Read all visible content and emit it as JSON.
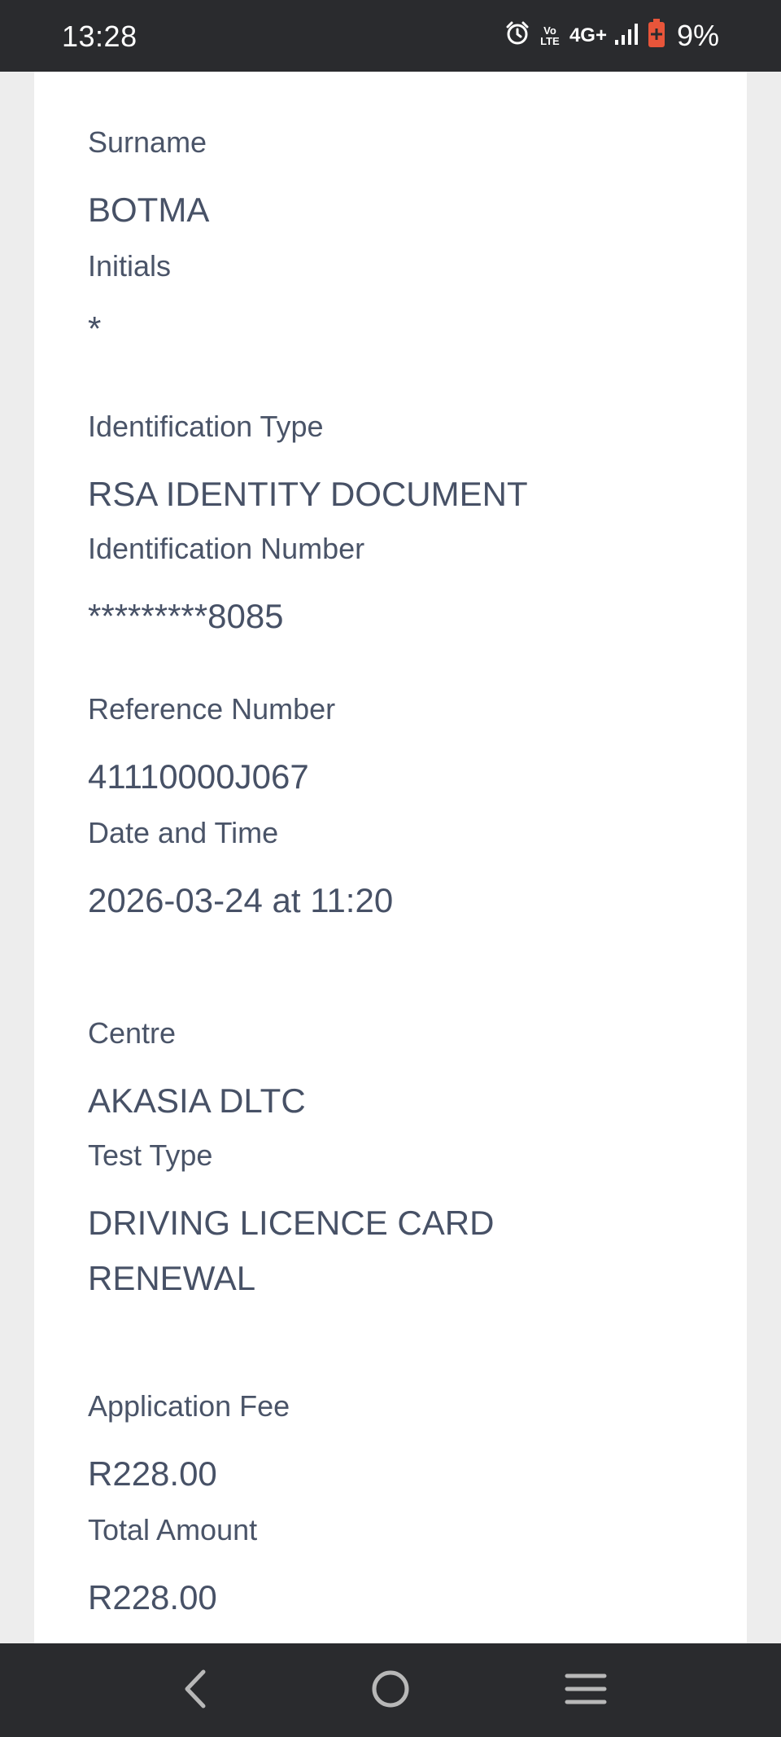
{
  "status_bar": {
    "time": "13:28",
    "network": "4G+",
    "volte": "Vo LTE",
    "battery_percent": "9%",
    "battery_color": "#e8553a"
  },
  "details": {
    "surname": {
      "label": "Surname",
      "value": "BOTMA"
    },
    "initials": {
      "label": "Initials",
      "value": "*"
    },
    "identification_type": {
      "label": "Identification Type",
      "value": "RSA IDENTITY DOCUMENT"
    },
    "identification_number": {
      "label": "Identification Number",
      "value": "*********8085"
    },
    "reference_number": {
      "label": "Reference Number",
      "value": "41110000J067"
    },
    "date_time": {
      "label": "Date and Time",
      "value": "2026-03-24 at 11:20"
    },
    "centre": {
      "label": "Centre",
      "value": "AKASIA DLTC"
    },
    "test_type": {
      "label": "Test Type",
      "value": "DRIVING LICENCE CARD RENEWAL"
    },
    "application_fee": {
      "label": "Application Fee",
      "value": "R228.00"
    },
    "total_amount": {
      "label": "Total Amount",
      "value": "R228.00"
    }
  },
  "nav_bar": {
    "back_icon": "chevron-left-icon",
    "home_icon": "circle-home-icon",
    "recents_icon": "menu-lines-icon"
  }
}
